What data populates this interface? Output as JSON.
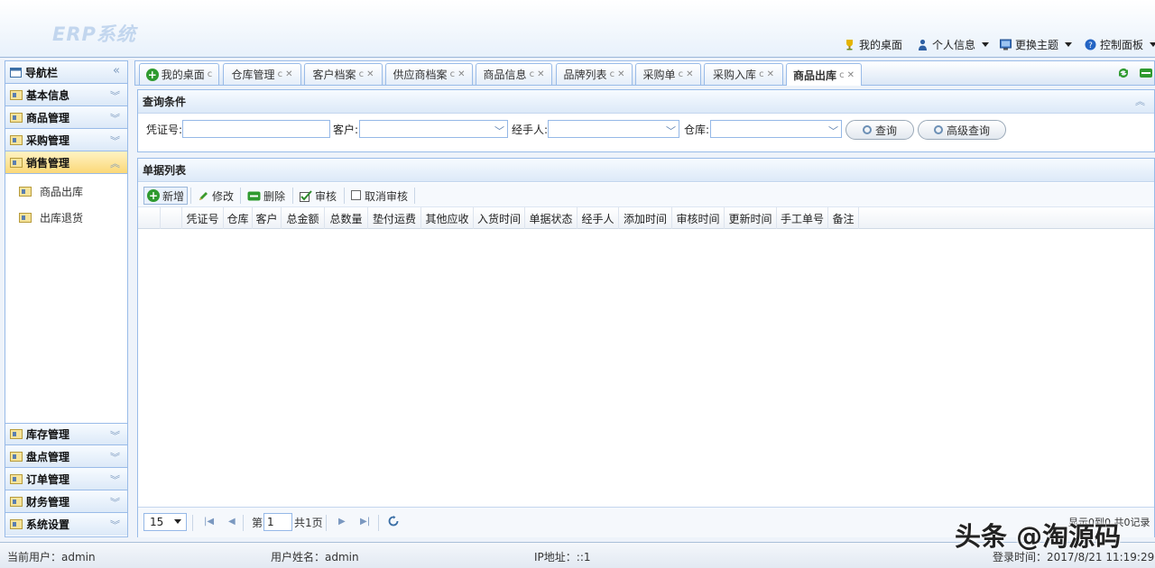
{
  "app": {
    "logo": "ERP系统"
  },
  "topnav": [
    {
      "label": "我的桌面",
      "icon": "trophy-icon",
      "caret": false
    },
    {
      "label": "个人信息",
      "icon": "user-icon",
      "caret": true
    },
    {
      "label": "更换主题",
      "icon": "theme-icon",
      "caret": true
    },
    {
      "label": "控制面板",
      "icon": "help-icon",
      "caret": true
    }
  ],
  "sidebar": {
    "title": "导航栏",
    "collapse_glyph": "«",
    "sections_top": [
      {
        "label": "基本信息",
        "chevron": "︾"
      },
      {
        "label": "商品管理",
        "chevron": "︾"
      },
      {
        "label": "采购管理",
        "chevron": "︾"
      }
    ],
    "active": {
      "label": "销售管理",
      "chevron": "︽"
    },
    "subitems": [
      "商品出库",
      "出库退货"
    ],
    "sections_bottom": [
      {
        "label": "库存管理",
        "chevron": "︾"
      },
      {
        "label": "盘点管理",
        "chevron": "︾"
      },
      {
        "label": "订单管理",
        "chevron": "︾"
      },
      {
        "label": "财务管理",
        "chevron": "︾"
      },
      {
        "label": "系统设置",
        "chevron": "︾"
      }
    ]
  },
  "tabs": [
    {
      "label": "我的桌面",
      "ctl": "c",
      "closable": false
    },
    {
      "label": "仓库管理",
      "ctl": "c",
      "closable": true
    },
    {
      "label": "客户档案",
      "ctl": "c",
      "closable": true
    },
    {
      "label": "供应商档案",
      "ctl": "c",
      "closable": true
    },
    {
      "label": "商品信息",
      "ctl": "c",
      "closable": true
    },
    {
      "label": "品牌列表",
      "ctl": "c",
      "closable": true
    },
    {
      "label": "采购单",
      "ctl": "c",
      "closable": true
    },
    {
      "label": "采购入库",
      "ctl": "c",
      "closable": true
    },
    {
      "label": "商品出库",
      "ctl": "c",
      "closable": true,
      "active": true
    }
  ],
  "query": {
    "title": "查询条件",
    "fields": [
      {
        "label": "凭证号:",
        "value": ""
      },
      {
        "label": "客户:",
        "value": ""
      },
      {
        "label": "经手人:",
        "value": ""
      },
      {
        "label": "仓库:",
        "value": ""
      }
    ],
    "search_label": "查询",
    "advanced_label": "高级查询",
    "collapse_glyph": "︽"
  },
  "list": {
    "title": "单据列表",
    "toolbar": [
      "新增",
      "修改",
      "删除",
      "审核",
      "取消审核"
    ],
    "columns": [
      "凭证号",
      "仓库",
      "客户",
      "总金额",
      "总数量",
      "垫付运费",
      "其他应收",
      "入货时间",
      "单据状态",
      "经手人",
      "添加时间",
      "审核时间",
      "更新时间",
      "手工单号",
      "备注"
    ],
    "rows": []
  },
  "pager": {
    "page_size": "15",
    "page_prefix": "第",
    "page": "1",
    "page_total": "共1页",
    "summary": "显示0到0,共0记录"
  },
  "status": {
    "current_user": "当前用户：admin",
    "user_name": "用户姓名：admin",
    "ip": "IP地址：::1",
    "login_time": "登录时间：2017/8/21 11:19:29"
  },
  "watermark": "头条 @淘源码",
  "colors": {
    "accent": "#99bbe8",
    "active_section": "#fbd878",
    "add_green": "#2f9a2f"
  }
}
